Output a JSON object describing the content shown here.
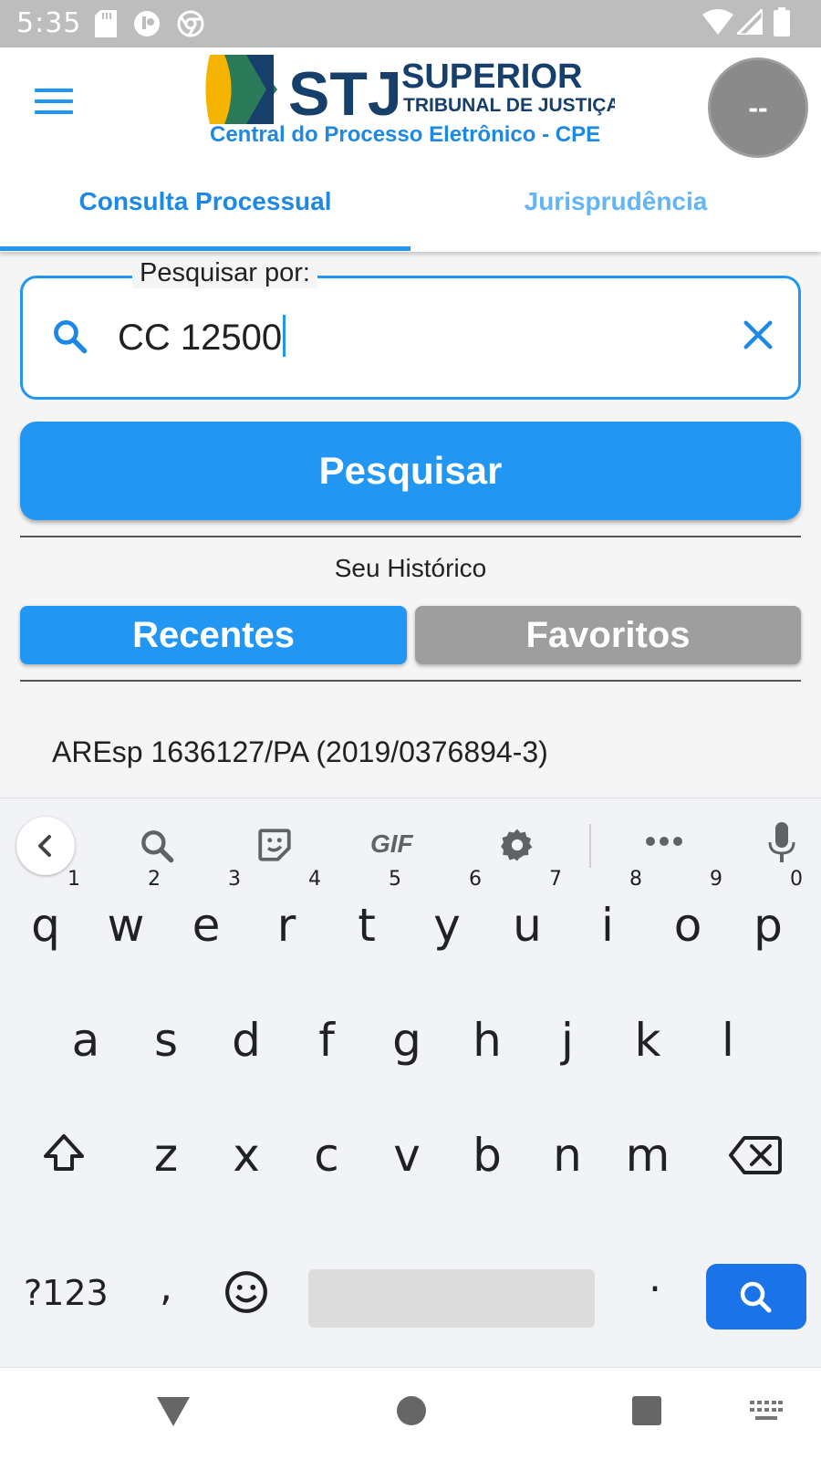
{
  "status_bar": {
    "time": "5:35",
    "background": "#bdbdbd"
  },
  "header": {
    "logo_text": "STJ SUPERIOR TRIBUNAL DE JUSTIÇA",
    "subtitle": "Central do Processo Eletrônico - CPE",
    "avatar_label": "--",
    "menu_icon": "hamburger-icon"
  },
  "tabs": [
    {
      "label": "Consulta Processual",
      "active": true
    },
    {
      "label": "Jurisprudência",
      "active": false
    }
  ],
  "search": {
    "legend": "Pesquisar por:",
    "value": "CC 12500",
    "button_label": "Pesquisar"
  },
  "history": {
    "title": "Seu Histórico",
    "segments": [
      {
        "label": "Recentes",
        "active": true
      },
      {
        "label": "Favoritos",
        "active": false
      }
    ],
    "items": [
      "AREsp 1636127/PA (2019/0376894-3)"
    ]
  },
  "keyboard": {
    "row1": [
      "q",
      "w",
      "e",
      "r",
      "t",
      "y",
      "u",
      "i",
      "o",
      "p"
    ],
    "row1_hints": [
      "1",
      "2",
      "3",
      "4",
      "5",
      "6",
      "7",
      "8",
      "9",
      "0"
    ],
    "row2": [
      "a",
      "s",
      "d",
      "f",
      "g",
      "h",
      "j",
      "k",
      "l"
    ],
    "row3": [
      "z",
      "x",
      "c",
      "v",
      "b",
      "n",
      "m"
    ],
    "symbols_label": "?123",
    "comma": ",",
    "period": ".",
    "gif_label": "GIF"
  },
  "colors": {
    "accent": "#2196f3",
    "inactive_tab": "#64b5f6",
    "inactive_segment": "#9e9e9e",
    "keyboard_action": "#1a73e8"
  }
}
